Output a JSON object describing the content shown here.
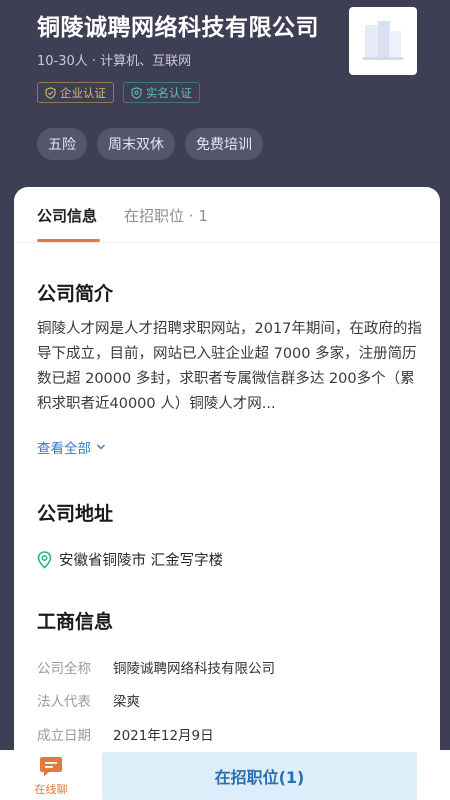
{
  "header": {
    "company_name": "铜陵诚聘网络科技有限公司",
    "meta": "10-30人 · 计算机、互联网",
    "badges": {
      "enterprise": "企业认证",
      "realname": "实名认证"
    },
    "tags": [
      "五险",
      "周末双休",
      "免费培训"
    ],
    "logo_icon": "building-logo-icon"
  },
  "tabs": {
    "company_info": "公司信息",
    "jobs": "在招职位 · 1"
  },
  "intro": {
    "title": "公司简介",
    "text": "铜陵人才网是人才招聘求职网站，2017年期间，在政府的指导下成立，目前，网站已入驻企业超 7000 多家，注册简历数已超 20000 多封，求职者专属微信群多达 200多个（累积求职者近40000 人）铜陵人才网...",
    "view_all": "查看全部"
  },
  "address": {
    "title": "公司地址",
    "text": "安徽省铜陵市 汇金写字楼"
  },
  "business": {
    "title": "工商信息",
    "rows": [
      {
        "label": "公司全称",
        "value": "铜陵诚聘网络科技有限公司"
      },
      {
        "label": "法人代表",
        "value": "梁爽"
      },
      {
        "label": "成立日期",
        "value": "2021年12月9日"
      }
    ]
  },
  "bottom": {
    "chat_label": "在线聊",
    "apply_label": "在招职位(1)"
  },
  "colors": {
    "header_bg": "#3e3f55",
    "accent_orange": "#e07a3c",
    "link_blue": "#3a78c9",
    "apply_bg": "#dceefa"
  }
}
